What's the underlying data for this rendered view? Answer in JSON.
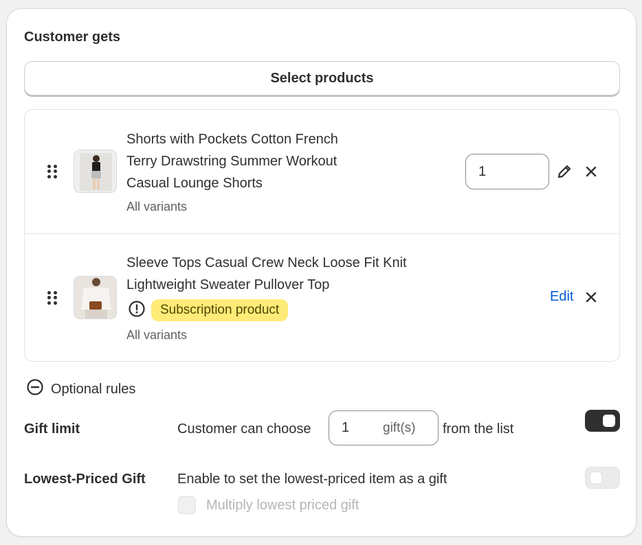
{
  "section": {
    "title": "Customer gets",
    "select_button": "Select products"
  },
  "products": [
    {
      "name_lines": [
        "Shorts with Pockets Cotton French",
        "Terry Drawstring Summer Workout",
        "Casual Lounge Shorts"
      ],
      "variants": "All variants",
      "quantity": "1"
    },
    {
      "name_lines": [
        "Sleeve Tops Casual Crew Neck Loose Fit Knit",
        "Lightweight Sweater Pullover Top"
      ],
      "badge": "Subscription product",
      "variants": "All variants",
      "edit_label": "Edit"
    }
  ],
  "optional_rules": {
    "label": "Optional rules"
  },
  "gift_limit": {
    "label": "Gift limit",
    "prefix": "Customer can choose",
    "value": "1",
    "suffix": "gift(s)",
    "postfix": "from the list",
    "enabled": true
  },
  "lowest_priced": {
    "label": "Lowest-Priced Gift",
    "description": "Enable to set the lowest-priced item as a gift",
    "enabled": false,
    "multiply_label": "Multiply lowest priced gift"
  },
  "colors": {
    "accent_link": "#005bd3",
    "badge_bg": "#ffeb78",
    "toggle_on": "#303030"
  },
  "icons": [
    "drag-handle-icon",
    "pencil-icon",
    "close-icon",
    "warning-circle-icon",
    "minus-circle-icon"
  ]
}
